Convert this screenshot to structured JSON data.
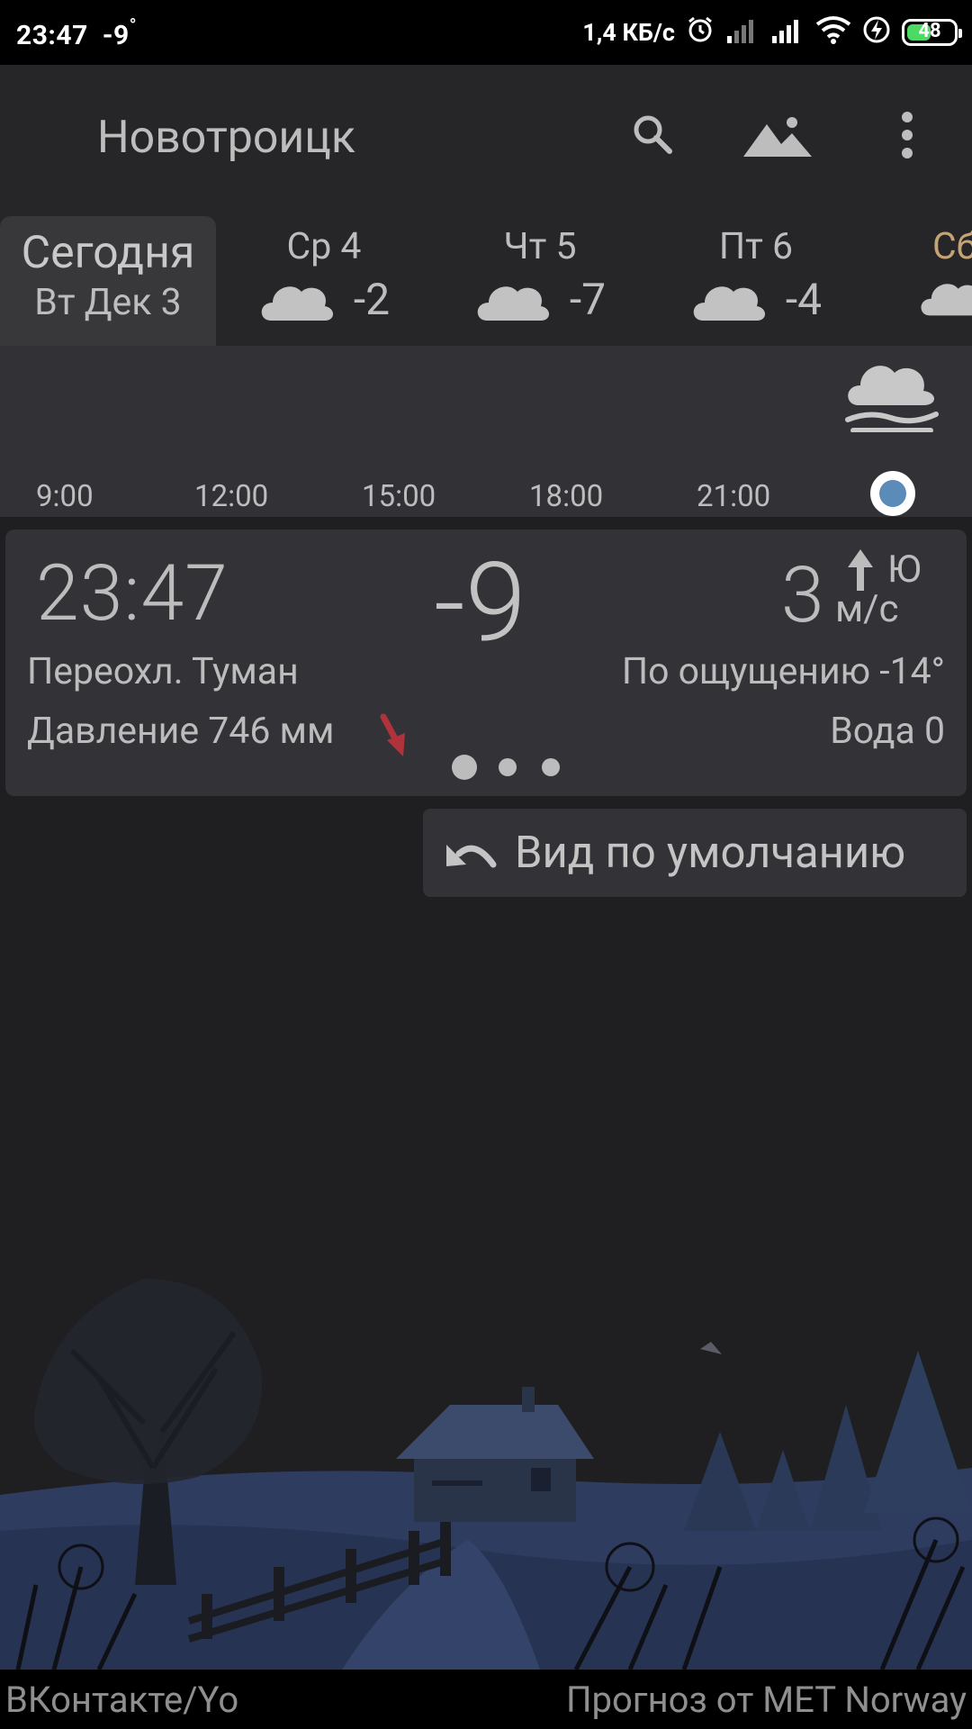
{
  "status_bar": {
    "time": "23:47",
    "temp": "-9",
    "deg": "°",
    "net_speed": "1,4 КБ/с",
    "battery": "48",
    "icons": [
      "alarm-icon",
      "signal-icon",
      "signal-icon",
      "wifi-icon",
      "charging-icon",
      "battery-icon"
    ]
  },
  "app_bar": {
    "city": "Новотроицк",
    "icons": [
      "search-icon",
      "landscape-icon",
      "more-vert-icon"
    ]
  },
  "days": {
    "today": {
      "title": "Сегодня",
      "date": "Вт Дек 3"
    },
    "list": [
      {
        "name": "Ср 4",
        "temp": "-2",
        "icon": "cloud-icon"
      },
      {
        "name": "Чт 5",
        "temp": "-7",
        "icon": "cloud-icon"
      },
      {
        "name": "Пт 6",
        "temp": "-4",
        "icon": "cloud-icon"
      },
      {
        "name": "Сб",
        "temp": "",
        "icon": "cloud-icon"
      }
    ]
  },
  "hourly": {
    "hours": [
      "9:00",
      "12:00",
      "15:00",
      "18:00",
      "21:00"
    ],
    "icon": "fog-icon"
  },
  "current": {
    "time": "23:47",
    "temp": "-9",
    "wind_speed": "3",
    "wind_dir": "Ю",
    "wind_unit": "м/с",
    "description": "Переохл. Туман",
    "feels_like": "По ощущению -14°",
    "pressure": "Давление 746 мм",
    "water": "Вода 0"
  },
  "reset_button": {
    "label": "Вид по умолчанию"
  },
  "footer": {
    "left": "ВКонтакте/Yo",
    "right": "Прогноз от MET Norway"
  },
  "colors": {
    "background": "#1f1f21",
    "card": "#333337",
    "accent_saturday": "#c5a374",
    "pressure_arrow": "#b0323a",
    "current_dot": "#5b8bb8"
  }
}
